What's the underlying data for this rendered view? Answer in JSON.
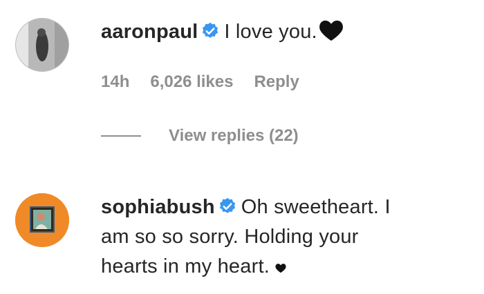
{
  "comments": [
    {
      "username": "aaronpaul",
      "verified": true,
      "text": "I love you.",
      "emoji": "black-heart",
      "time": "14h",
      "likes": "6,026 likes",
      "reply_label": "Reply",
      "view_replies": "View replies (22)"
    },
    {
      "username": "sophiabush",
      "verified": true,
      "text_line1": "Oh sweetheart. I",
      "text_line2": "am so so sorry. Holding your",
      "text_line3": "hearts in my heart.",
      "emoji": "small-black-heart"
    }
  ],
  "colors": {
    "text": "#262626",
    "muted": "#8e8e8e",
    "verified": "#3897f0",
    "avatar2_bg": "#f08a28"
  }
}
